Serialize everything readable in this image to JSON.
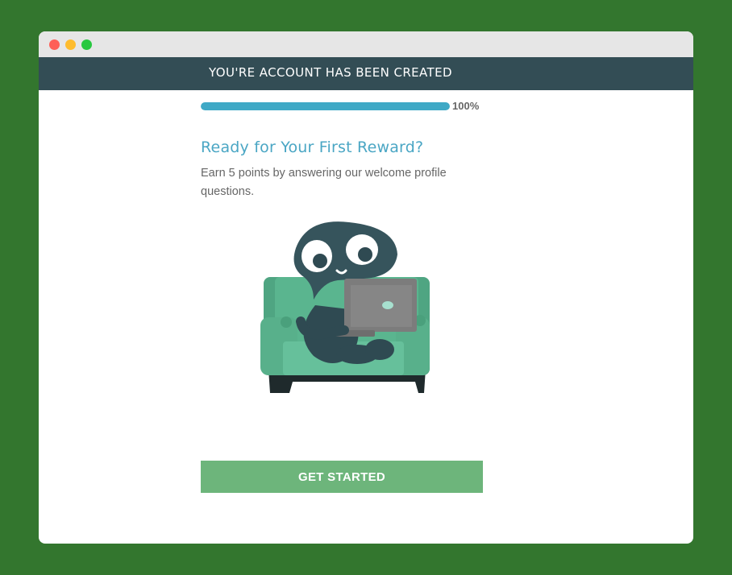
{
  "banner": {
    "title": "YOU'RE ACCOUNT HAS BEEN CREATED"
  },
  "progress": {
    "percent": 100,
    "label": "100%"
  },
  "main": {
    "heading": "Ready for Your First Reward?",
    "description": "Earn 5 points by answering our welcome profile questions."
  },
  "illustration": {
    "icon": "mascot-on-couch-with-laptop-icon"
  },
  "cta": {
    "label": "GET STARTED"
  },
  "colors": {
    "background": "#33762e",
    "banner": "#334d55",
    "accent": "#3fa9c6",
    "button": "#6db57b"
  }
}
